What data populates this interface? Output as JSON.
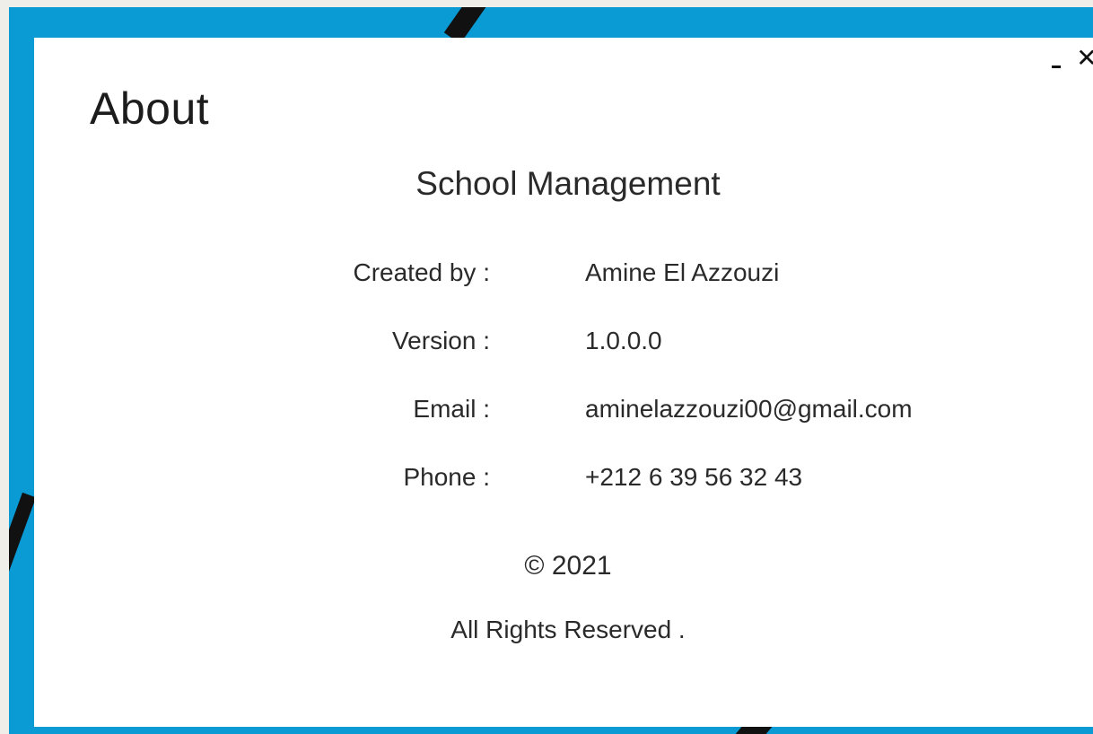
{
  "window": {
    "minimize_icon": "minimize-icon",
    "close_icon": "close-icon",
    "close_glyph": "✕"
  },
  "title": "About",
  "app_name": "School Management",
  "info": [
    {
      "label": "Created by :",
      "value": "Amine El Azzouzi"
    },
    {
      "label": "Version :",
      "value": "1.0.0.0"
    },
    {
      "label": "Email :",
      "value": "aminelazzouzi00@gmail.com"
    },
    {
      "label": "Phone :",
      "value": "+212 6 39 56 32 43"
    }
  ],
  "footer": {
    "copyright": "© 2021",
    "rights": "All Rights Reserved ."
  },
  "colors": {
    "frame": "#0a9ad4",
    "background": "#ffffff",
    "text": "#2a2a2a"
  }
}
